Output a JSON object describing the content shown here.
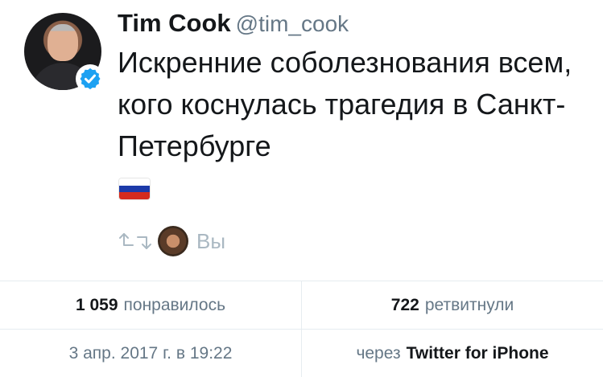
{
  "author": {
    "name": "Tim Cook",
    "handle": "@tim_cook",
    "verified": true
  },
  "tweet": {
    "text": "Искренние соболезнования всем, кого коснулась трагедия в Санкт-Петербурге",
    "flag": "russia-flag",
    "flag_colors": [
      "#ffffff",
      "#1c3aa9",
      "#d52b1e"
    ]
  },
  "social_context": {
    "label": "Вы"
  },
  "stats": {
    "likes_count": "1 059",
    "likes_label": "понравилось",
    "retweets_count": "722",
    "retweets_label": "ретвитнули",
    "timestamp": "3 апр. 2017 г. в 19:22",
    "via_label": "через",
    "via_app": "Twitter for iPhone"
  },
  "colors": {
    "verified_blue": "#1da1f2",
    "muted_text": "#657786",
    "divider": "#e6ecf0"
  }
}
